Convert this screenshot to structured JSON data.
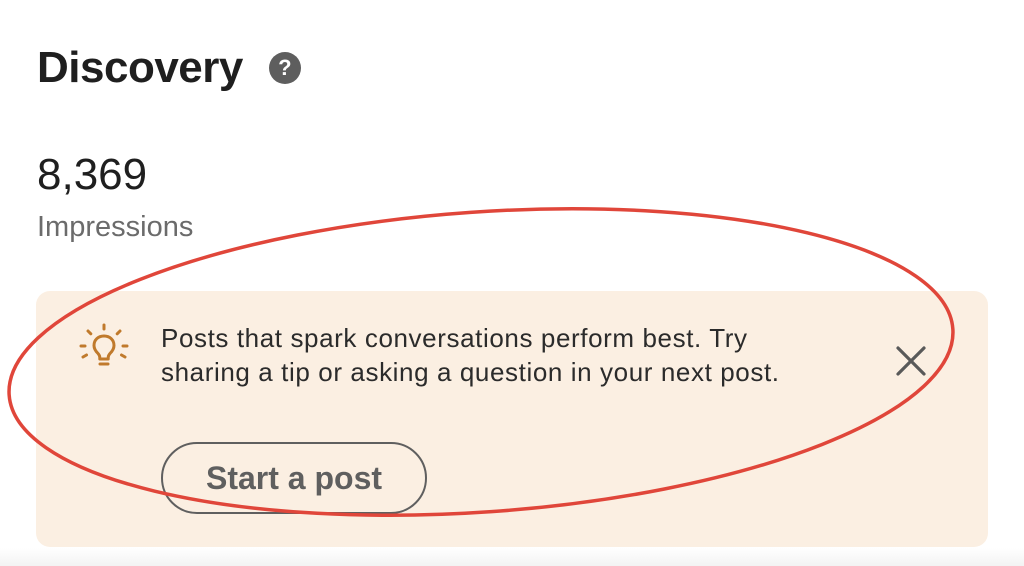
{
  "section": {
    "title": "Discovery",
    "help_icon": "question-mark-icon",
    "help_glyph": "?"
  },
  "metric": {
    "value": "8,369",
    "label": "Impressions"
  },
  "tip": {
    "icon": "lightbulb-icon",
    "text": "Posts that spark conversations perform best. Try sharing a tip or asking a question in your next post.",
    "close_icon": "close-icon",
    "button_label": "Start a post"
  },
  "colors": {
    "card_background": "#fbefe2",
    "bulb_accent": "#c07a2c",
    "annotation_red": "#e0463a"
  }
}
